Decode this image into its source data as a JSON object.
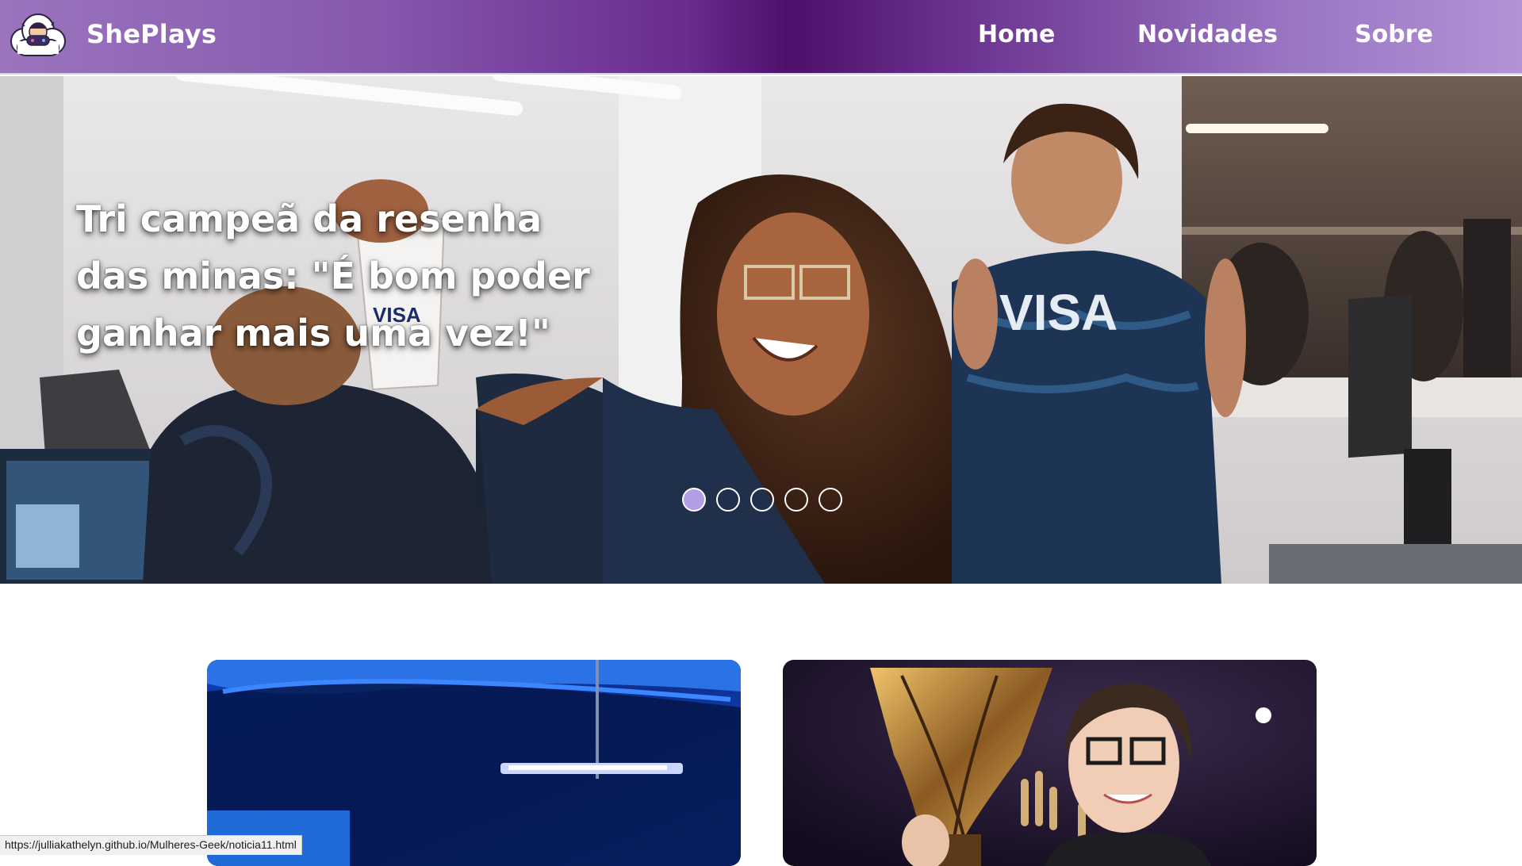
{
  "header": {
    "brand": "ShePlays",
    "logo_icon": "gamer-cloud-logo-icon",
    "nav": [
      {
        "label": "Home"
      },
      {
        "label": "Novidades"
      },
      {
        "label": "Sobre"
      }
    ],
    "gradient_colors": [
      "#9a74bd",
      "#4f0f6c",
      "#b392d6"
    ]
  },
  "hero": {
    "title": "Tri campeã da resenha das minas: \"É bom poder ganhar mais uma vez!\"",
    "slides_total": 5,
    "active_slide": 1,
    "active_dot_color": "#b19ee6"
  },
  "cards": [
    {
      "image_icon": "stage-lighting-image"
    },
    {
      "image_icon": "trophy-winner-image"
    }
  ],
  "status_bar": {
    "url": "https://julliakathelyn.github.io/Mulheres-Geek/noticia11.html"
  }
}
